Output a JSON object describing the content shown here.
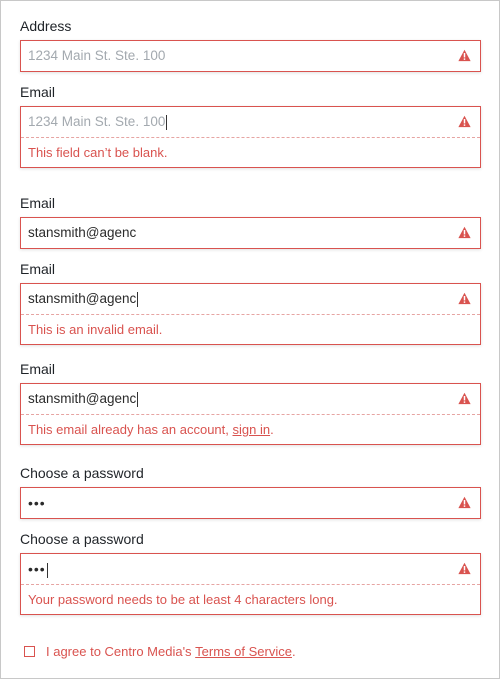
{
  "fields": [
    {
      "label": "Address",
      "value": "",
      "placeholder": "1234 Main St. Ste. 100",
      "error": ""
    },
    {
      "label": "Email",
      "value": "",
      "placeholder": "1234 Main St. Ste. 100",
      "error": "This field can’t be blank."
    },
    {
      "label": "Email",
      "value": "stansmith@agenc",
      "placeholder": "",
      "error": ""
    },
    {
      "label": "Email",
      "value": "stansmith@agenc",
      "placeholder": "",
      "error": "This is an invalid email."
    },
    {
      "label": "Email",
      "value": "stansmith@agenc",
      "placeholder": "",
      "error_prefix": "This email already has an account, ",
      "error_link": "sign in",
      "error_suffix": "."
    },
    {
      "label": "Choose a password",
      "value": "•••",
      "placeholder": "",
      "error": ""
    },
    {
      "label": "Choose a password",
      "value": "•••",
      "placeholder": "",
      "error": "Your password needs to be at least 4 characters long."
    }
  ],
  "terms": {
    "prefix": "I agree to Centro Media's ",
    "link": "Terms of Service",
    "suffix": "."
  },
  "colors": {
    "error": "#d9534f",
    "placeholder": "#a3a9af",
    "text": "#2b2b2b"
  },
  "icons": {
    "warning": "warning-triangle-icon"
  }
}
